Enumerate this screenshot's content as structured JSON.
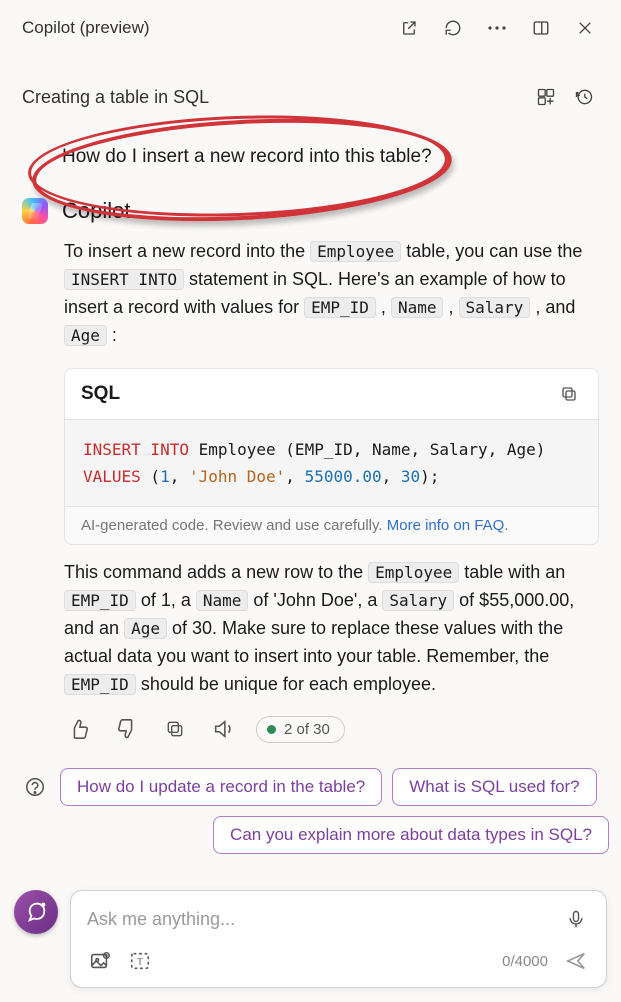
{
  "header": {
    "title": "Copilot (preview)"
  },
  "topic": {
    "label": "Creating a table in SQL"
  },
  "user_prompt": "How do I insert a new record into this table?",
  "response": {
    "sender": "Copilot",
    "para1_pre": "To insert a new record into the ",
    "code_employee": "Employee",
    "para1_mid": " table, you can use the ",
    "code_insert": "INSERT INTO",
    "para1_post1": " statement in SQL. Here's an example of how to insert a record with values for ",
    "code_empid": "EMP_ID",
    "comma1": " , ",
    "code_name": "Name",
    "comma2": " , ",
    "code_salary": "Salary",
    "comma3": " , and ",
    "code_age": "Age",
    "colon": " :",
    "codeblock": {
      "lang": "SQL",
      "kw1": "INSERT INTO",
      "line1_rest": " Employee (EMP_ID, Name, Salary, Age)",
      "kw2": "VALUES",
      "paren_open": " (",
      "num1": "1",
      "sep1": ", ",
      "str1": "'John Doe'",
      "sep2": ", ",
      "num2": "55000.00",
      "sep3": ", ",
      "num3": "30",
      "paren_close": ");",
      "disclaimer": "AI-generated code. Review and use carefully. ",
      "faq_link": "More info on FAQ"
    },
    "para2_pre": "This command adds a new row to the ",
    "para2_t1": " table with an ",
    "para2_t2": " of 1, a ",
    "para2_t3": " of 'John Doe', a ",
    "para2_t4": " of $55,000.00, and an ",
    "para2_t5": " of 30. Make sure to replace these values with the actual data you want to insert into your table. Remember, the ",
    "para2_t6": " should be unique for each employee.",
    "counter": "2 of 30"
  },
  "suggestions": {
    "s1": "How do I update a record in the table?",
    "s2": "What is SQL used for?",
    "s3": "Can you explain more about data types in SQL?"
  },
  "composer": {
    "placeholder": "Ask me anything...",
    "char_count": "0/4000"
  }
}
